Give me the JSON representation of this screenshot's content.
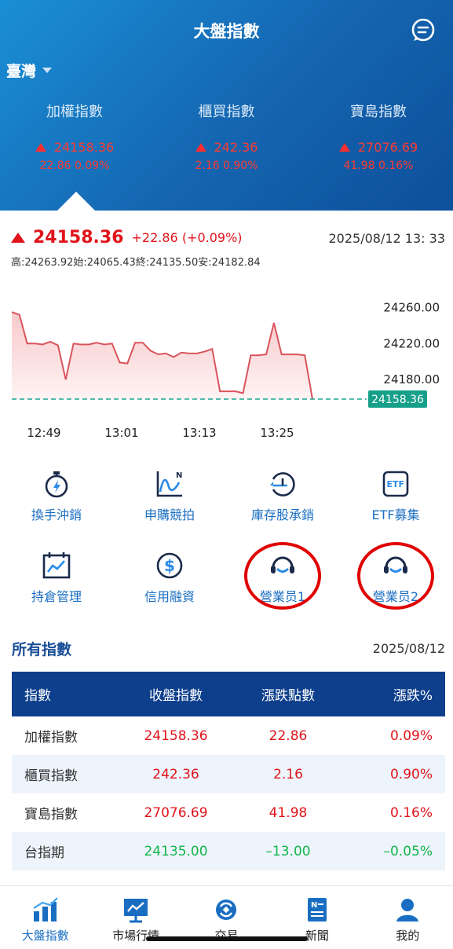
{
  "header": {
    "title": "大盤指數",
    "region": "臺灣",
    "indices": [
      {
        "name": "加權指數",
        "value": "24158.36",
        "change": "22.86 0.09%"
      },
      {
        "name": "櫃買指數",
        "value": "242.36",
        "change": "2.16 0.90%"
      },
      {
        "name": "寶島指數",
        "value": "27076.69",
        "change": "41.98 0.16%"
      }
    ]
  },
  "quote": {
    "price": "24158.36",
    "change": "+22.86  (+0.09%)",
    "datetime": "2025/08/12 13: 33",
    "hilo": "高:24263.92始:24065.43終:24135.50安:24182.84"
  },
  "chart_data": {
    "type": "line",
    "y_ticks": [
      "24260.00",
      "24220.00",
      "24180.00"
    ],
    "x_ticks": [
      "12:49",
      "13:01",
      "13:13",
      "13:25"
    ],
    "current_label": "24158.36",
    "ylim": [
      24158.36,
      24270
    ],
    "series": [
      {
        "values": [
          24255,
          24252,
          24220,
          24220,
          24219,
          24222,
          24218,
          24180,
          24220,
          24219,
          24219,
          24221,
          24219,
          24220,
          24199,
          24198,
          24221,
          24221,
          24212,
          24208,
          24209,
          24205,
          24210,
          24209,
          24209,
          24211,
          24214,
          24167,
          24167,
          24167,
          24165,
          24207,
          24207,
          24208,
          24243,
          24208,
          24208,
          24208,
          24207,
          24158.36
        ]
      }
    ]
  },
  "actions": [
    {
      "label": "換手沖銷",
      "icon": "stopwatch-icon"
    },
    {
      "label": "申購競拍",
      "icon": "trend-chart-icon"
    },
    {
      "label": "庫存股承銷",
      "icon": "clock-arrow-icon"
    },
    {
      "label": "ETF募集",
      "icon": "etf-icon"
    },
    {
      "label": "持倉管理",
      "icon": "calendar-chart-icon"
    },
    {
      "label": "信用融資",
      "icon": "dollar-icon"
    },
    {
      "label": "營業员1",
      "icon": "headset-icon"
    },
    {
      "label": "營業员2",
      "icon": "headset-icon"
    }
  ],
  "index_table": {
    "title": "所有指數",
    "date": "2025/08/12",
    "headers": [
      "指數",
      "收盤指數",
      "漲跌點數",
      "漲跌%"
    ],
    "rows": [
      {
        "name": "加權指數",
        "close": "24158.36",
        "points": "22.86",
        "pct": "0.09%"
      },
      {
        "name": "櫃買指數",
        "close": "242.36",
        "points": "2.16",
        "pct": "0.90%"
      },
      {
        "name": "寶島指數",
        "close": "27076.69",
        "points": "41.98",
        "pct": "0.16%"
      },
      {
        "name": "台指期",
        "close": "24135.00",
        "points": "–13.00",
        "pct": "–0.05%"
      }
    ]
  },
  "nav": [
    {
      "label": "大盤指數",
      "icon": "index-bars-icon"
    },
    {
      "label": "市場行情",
      "icon": "market-board-icon"
    },
    {
      "label": "交易",
      "icon": "exchange-icon"
    },
    {
      "label": "新聞",
      "icon": "news-icon"
    },
    {
      "label": "我的",
      "icon": "user-icon"
    }
  ],
  "colors": {
    "up": "#e0141b",
    "down": "#12b64a",
    "brand": "#1a6ec2",
    "header": "#1565b0"
  }
}
